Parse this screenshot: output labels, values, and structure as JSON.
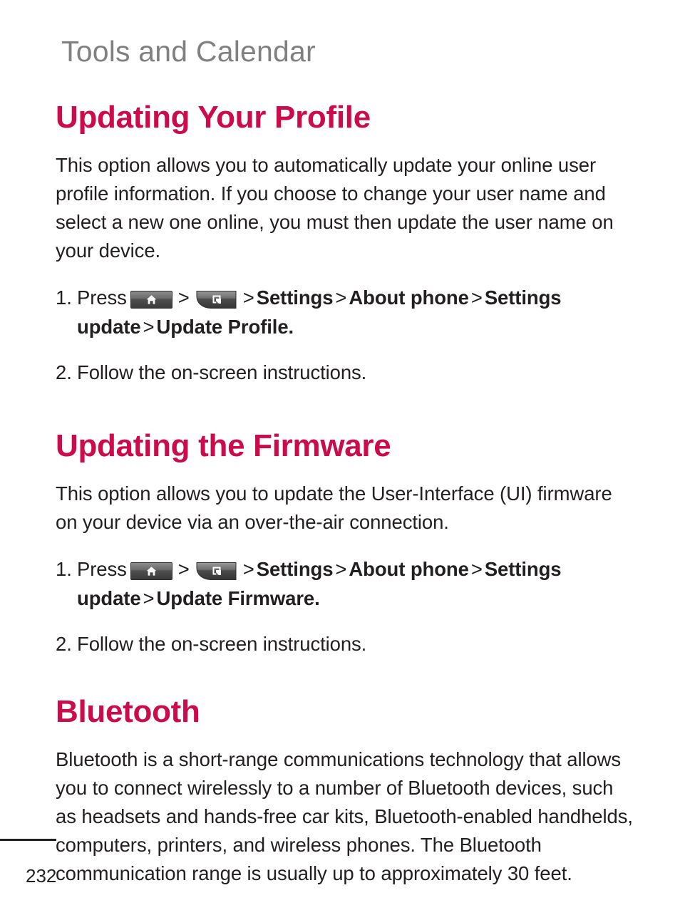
{
  "page": {
    "running_header": "Tools and Calendar",
    "page_number": "232",
    "heading_color": "#CC0B4A",
    "header_color": "#808080",
    "body_color": "#231F20",
    "background_color": "#FFFFFF"
  },
  "sections": [
    {
      "title": "Updating Your Profile",
      "paragraph": "This option allows you to automatically update your online user profile information. If you choose to change your user name and select a new one online, you must then update the user name on your device.",
      "steps": [
        {
          "number": "1.",
          "lead": "Press",
          "icons": [
            "home-key-icon",
            "menu-key-icon"
          ],
          "separator": ">",
          "path": [
            "Settings",
            "About phone",
            "Settings update",
            "Update Profile"
          ],
          "trailing_period": "."
        },
        {
          "number": "2.",
          "text": "Follow the on-screen instructions."
        }
      ]
    },
    {
      "title": "Updating the Firmware",
      "paragraph": "This option allows you to update the User-Interface (UI) firmware on your device via an over-the-air connection.",
      "steps": [
        {
          "number": "1.",
          "lead": "Press",
          "icons": [
            "home-key-icon",
            "menu-key-icon"
          ],
          "separator": ">",
          "path": [
            "Settings",
            "About phone",
            "Settings update",
            "Update Firmware"
          ],
          "trailing_period": "."
        },
        {
          "number": "2.",
          "text": "Follow the on-screen instructions."
        }
      ]
    },
    {
      "title": "Bluetooth",
      "paragraph": "Bluetooth is a short-range communications technology that allows you to connect wirelessly to a number of Bluetooth devices, such as headsets and hands-free car kits, Bluetooth-enabled handhelds, computers, printers, and wireless phones. The Bluetooth communication range is usually up to approximately 30 feet."
    }
  ],
  "step_fragments": {
    "s1_lead": "Press",
    "s1_sep1": ">",
    "s1_sep2": ">",
    "s1_sep3": ">",
    "s1_sep4": ">",
    "s1_sep5": ">",
    "s1_settings": "Settings",
    "s1_about": "About phone",
    "s1_settings_update_a": "Settings",
    "s1_settings_update_b": "update",
    "s1_target_profile": "Update Profile",
    "s1_target_firmware": "Update Firmware",
    "s1_period": ".",
    "s2_text": "Follow the on-screen instructions.",
    "num1": "1.",
    "num2": "2."
  }
}
